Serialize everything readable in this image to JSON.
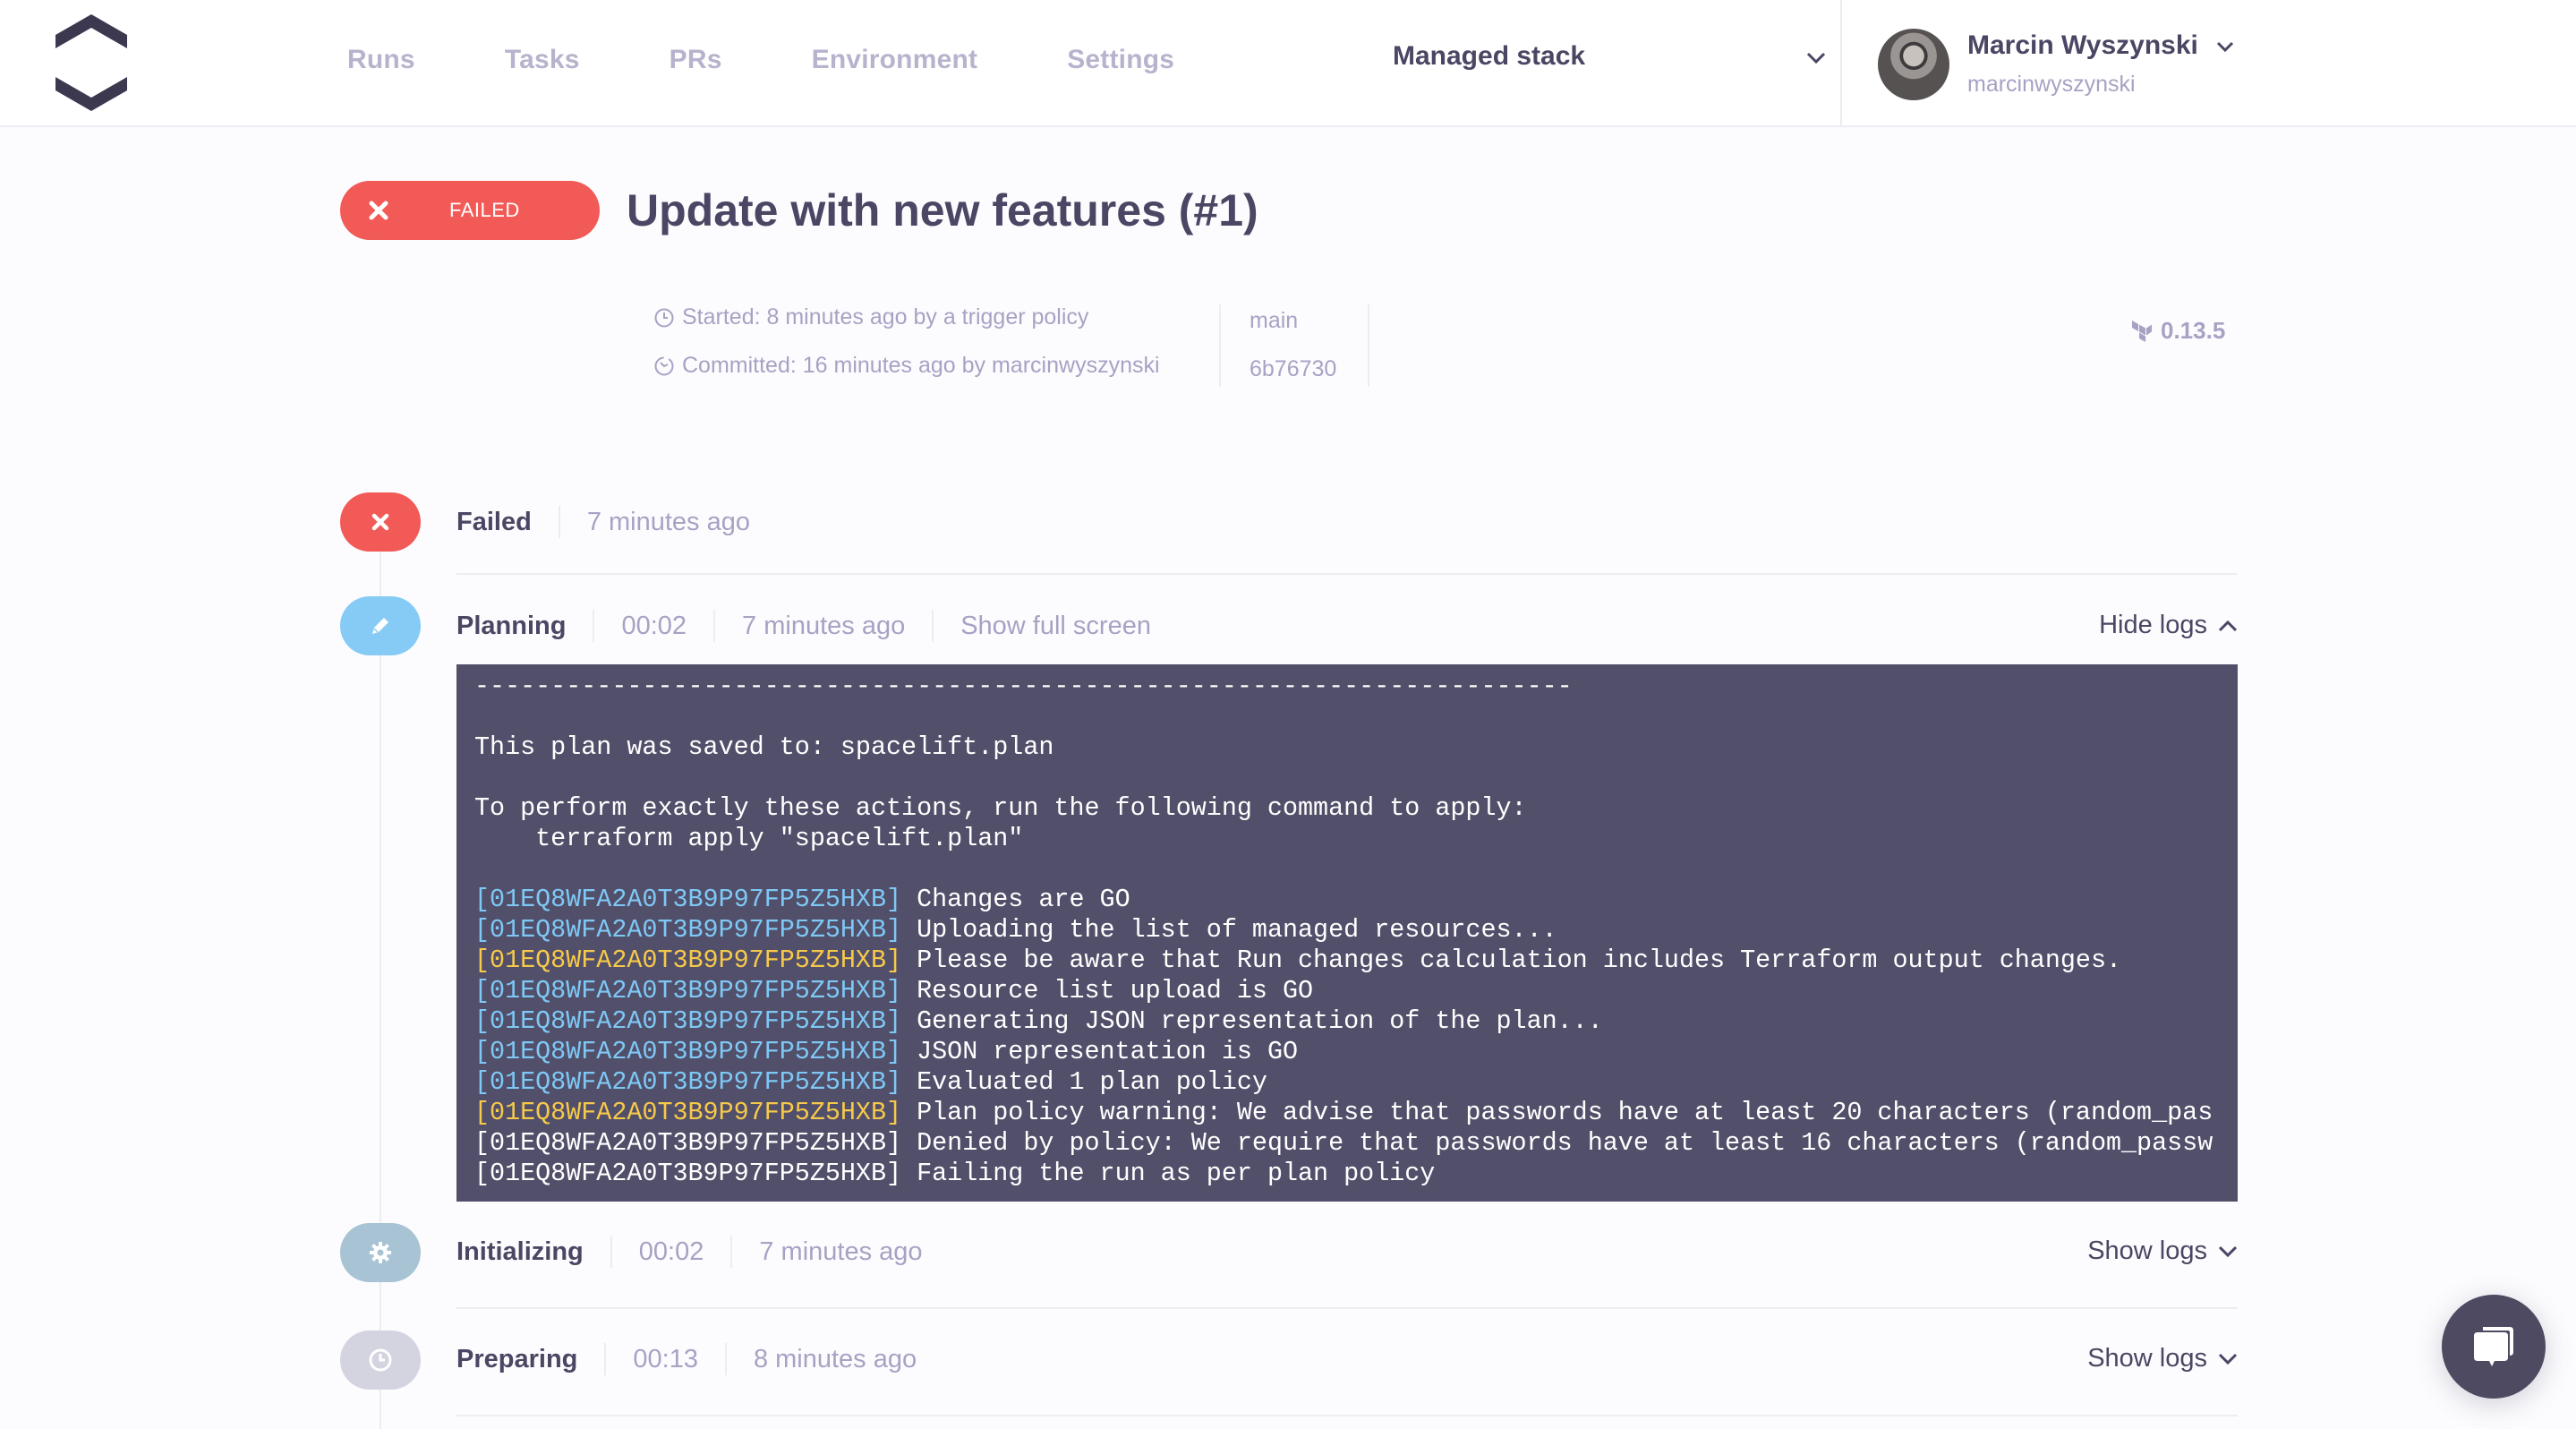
{
  "header": {
    "logo": "spacelift-logo",
    "nav": [
      "Runs",
      "Tasks",
      "PRs",
      "Environment",
      "Settings"
    ],
    "stack_select": {
      "selected": "Managed stack"
    },
    "user": {
      "name": "Marcin Wyszynski",
      "handle": "marcinwyszynski"
    }
  },
  "run": {
    "status": "FAILED",
    "status_color": "#f25a57",
    "title": "Update with new features (#1)",
    "started": "Started: 8 minutes ago by a trigger policy",
    "committed": "Committed: 16 minutes ago by marcinwyszynski",
    "branch": "main",
    "commit_sha": "6b76730",
    "terraform_version": "0.13.5"
  },
  "steps": [
    {
      "title": "Failed",
      "time_ago": "7 minutes ago",
      "icon": "close-icon",
      "color": "#f25a57"
    },
    {
      "title": "Planning",
      "duration": "00:02",
      "time_ago": "7 minutes ago",
      "full_screen_label": "Show full screen",
      "logs_toggle": "Hide logs",
      "icon": "pencil-icon",
      "color": "#86cbf5"
    },
    {
      "title": "Initializing",
      "duration": "00:02",
      "time_ago": "7 minutes ago",
      "logs_toggle": "Show logs",
      "icon": "gear-icon",
      "color": "#a7c3d4"
    },
    {
      "title": "Preparing",
      "duration": "00:13",
      "time_ago": "8 minutes ago",
      "logs_toggle": "Show logs",
      "icon": "clock-icon",
      "color": "#d4d3e0"
    }
  ],
  "log": {
    "colors": {
      "info": "#7ec8f5",
      "warn": "#f6c94a",
      "error": "#f25a57"
    },
    "lines": [
      {
        "prefix": "",
        "text": "------------------------------------------------------------------------"
      },
      {
        "prefix": "",
        "text": ""
      },
      {
        "prefix": "",
        "text": "This plan was saved to: spacelift.plan"
      },
      {
        "prefix": "",
        "text": ""
      },
      {
        "prefix": "",
        "text": "To perform exactly these actions, run the following command to apply:"
      },
      {
        "prefix": "",
        "text": "    terraform apply \"spacelift.plan\""
      },
      {
        "prefix": "",
        "text": ""
      },
      {
        "prefix": "[01EQ8WFA2A0T3B9P97FP5Z5HXB]",
        "level": "info",
        "text": " Changes are GO"
      },
      {
        "prefix": "[01EQ8WFA2A0T3B9P97FP5Z5HXB]",
        "level": "info",
        "text": " Uploading the list of managed resources..."
      },
      {
        "prefix": "[01EQ8WFA2A0T3B9P97FP5Z5HXB]",
        "level": "warn",
        "text": " Please be aware that Run changes calculation includes Terraform output changes."
      },
      {
        "prefix": "[01EQ8WFA2A0T3B9P97FP5Z5HXB]",
        "level": "info",
        "text": " Resource list upload is GO"
      },
      {
        "prefix": "[01EQ8WFA2A0T3B9P97FP5Z5HXB]",
        "level": "info",
        "text": " Generating JSON representation of the plan..."
      },
      {
        "prefix": "[01EQ8WFA2A0T3B9P97FP5Z5HXB]",
        "level": "info",
        "text": " JSON representation is GO"
      },
      {
        "prefix": "[01EQ8WFA2A0T3B9P97FP5Z5HXB]",
        "level": "info",
        "text": " Evaluated 1 plan policy"
      },
      {
        "prefix": "[01EQ8WFA2A0T3B9P97FP5Z5HXB]",
        "level": "warn",
        "text": " Plan policy warning: We advise that passwords have at least 20 characters (random_pas"
      },
      {
        "prefix": "[01EQ8WFA2A0T3B9P97FP5Z5HXB]",
        "level": "error",
        "text": " Denied by policy: We require that passwords have at least 16 characters (random_passw"
      },
      {
        "prefix": "[01EQ8WFA2A0T3B9P97FP5Z5HXB]",
        "level": "error",
        "text": " Failing the run as per plan policy"
      }
    ]
  },
  "chat_widget": {
    "icon": "chat-icon"
  }
}
